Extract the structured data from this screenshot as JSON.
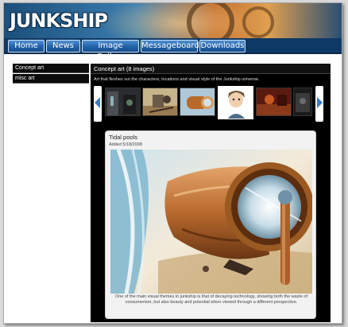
{
  "site": {
    "logo_text": "JUNKSHIP"
  },
  "nav": {
    "items": [
      {
        "label": "Home"
      },
      {
        "label": "News"
      },
      {
        "label": "Image Gallery"
      },
      {
        "label": "Messageboard"
      },
      {
        "label": "Downloads"
      }
    ]
  },
  "sidebar": {
    "items": [
      {
        "label": "Concept art"
      },
      {
        "label": "misc art"
      }
    ]
  },
  "gallery": {
    "title": "Concept art (8 images)",
    "description": "Art that fleshes out the characters, locations and visual style of the Junkship universe.",
    "prev_icon": "chevron-left-icon",
    "next_icon": "chevron-right-icon"
  },
  "viewer": {
    "title": "Tidal pools",
    "date": "Added 5/18/2008",
    "caption": "One of the main visual themes in junkship is that of decaying technology, showing both the waste of consumerism, but also beauty and potential when viewed through a different perspective."
  },
  "colors": {
    "nav_bg": "#0e3966",
    "nav_button": "#2262a8",
    "panel_bg": "#000000",
    "viewer_bg": "#f2f2f2"
  }
}
